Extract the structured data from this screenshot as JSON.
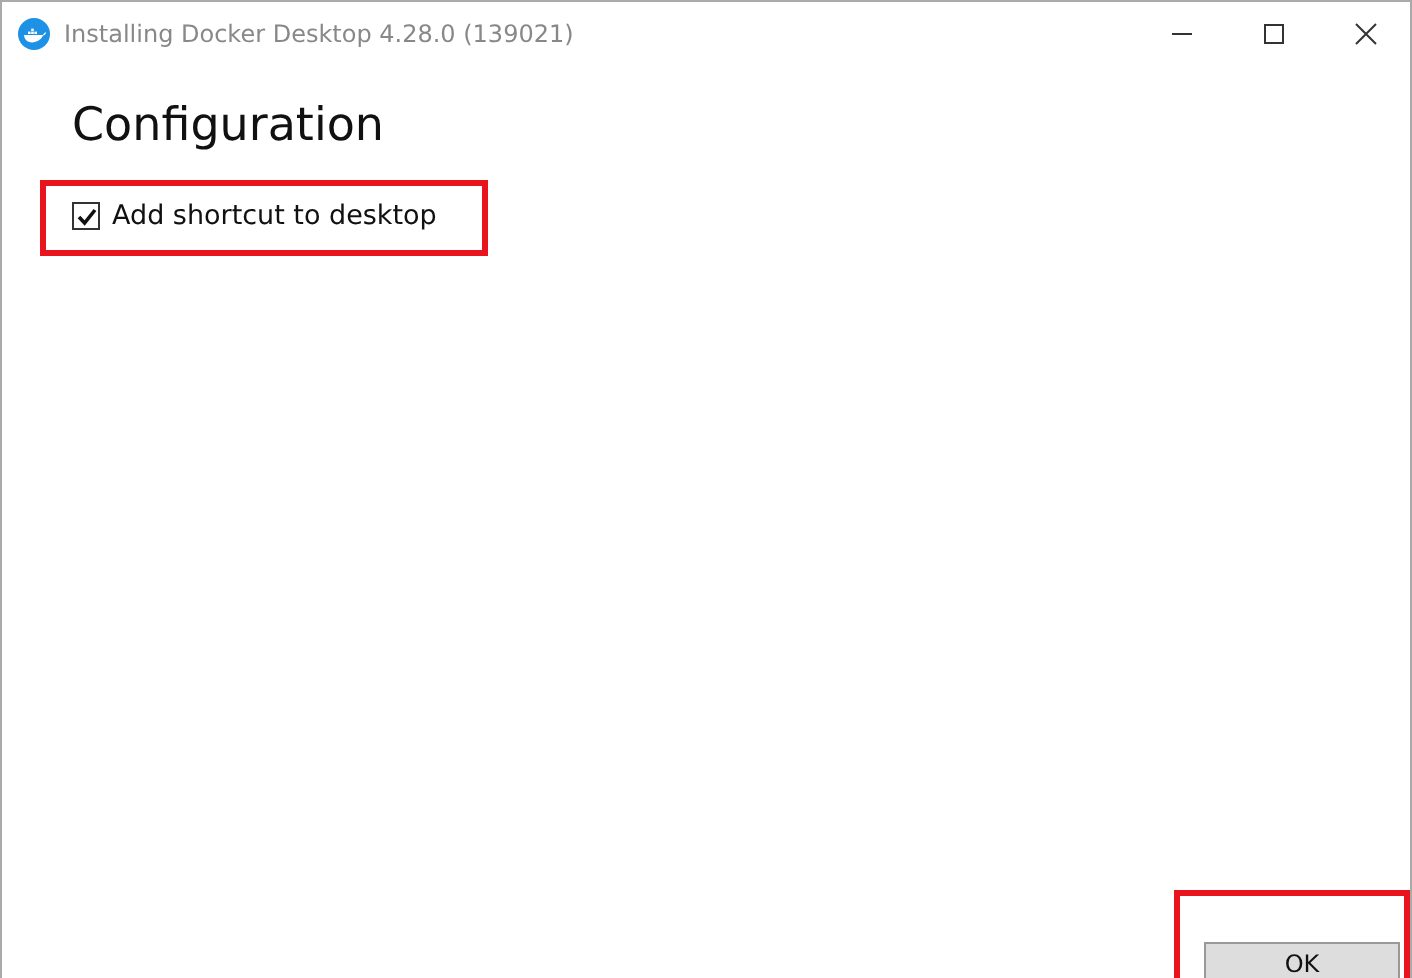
{
  "window": {
    "title": "Installing Docker Desktop 4.28.0 (139021)"
  },
  "heading": "Configuration",
  "options": [
    {
      "label": "Add shortcut to desktop",
      "checked": true
    }
  ],
  "buttons": [
    "OK"
  ]
}
